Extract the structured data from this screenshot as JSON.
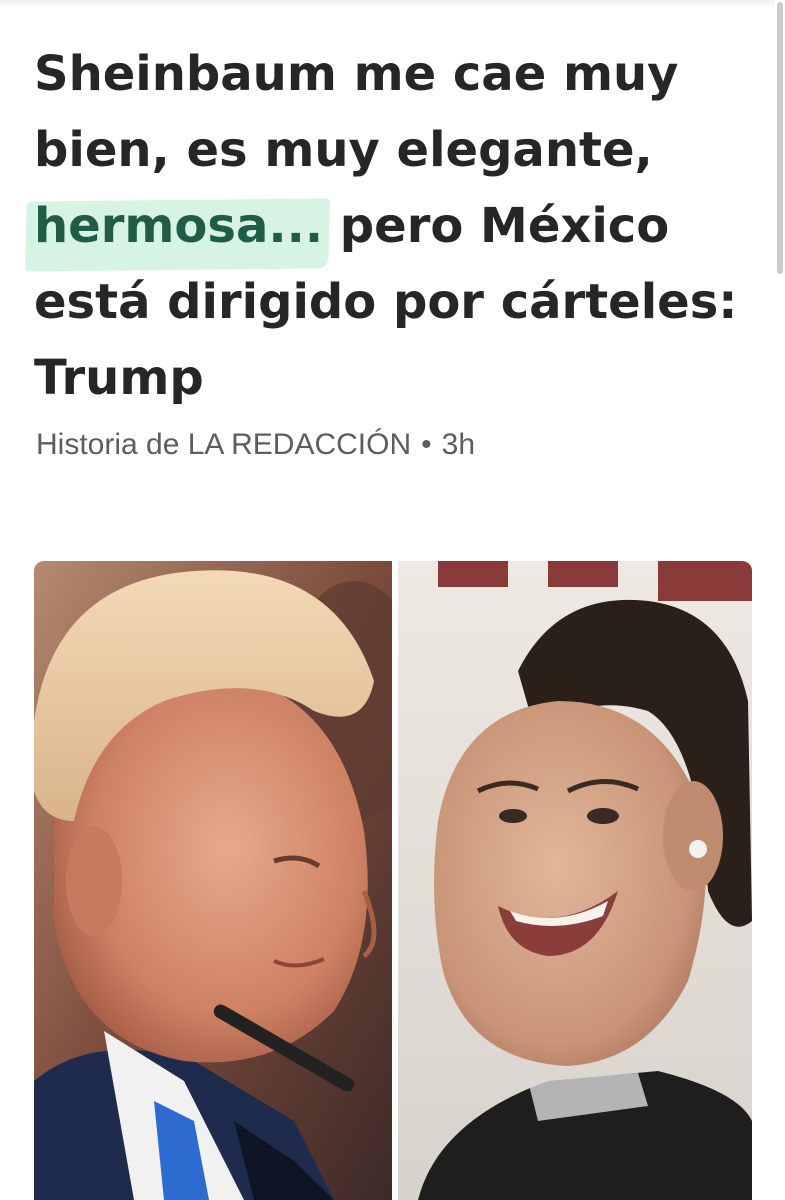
{
  "article": {
    "headline_before": "Sheinbaum me cae muy bien, es muy elegante, ",
    "headline_highlight": "hermosa...",
    "headline_after": " pero México está dirigido por cárteles: Trump",
    "source_prefix": "Historia de",
    "source_name": "LA REDACCIÓN",
    "separator": "•",
    "age": "3h"
  },
  "image": {
    "left_photo": "portrait-man-profile",
    "right_photo": "portrait-woman-smiling"
  },
  "colors": {
    "headline_text": "#262626",
    "highlight_background": "#d6f3e4",
    "highlight_text": "#215c46",
    "meta_text": "#5d5d5d"
  }
}
